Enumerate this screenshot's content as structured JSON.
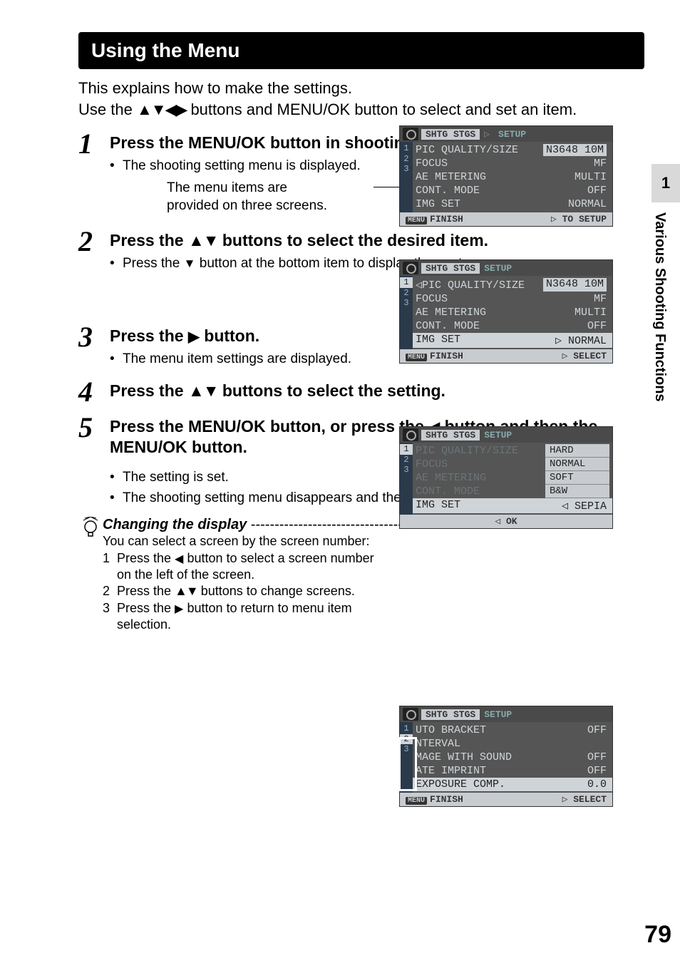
{
  "section_title": "Using the Menu",
  "intro_line1": "This explains how to make the settings.",
  "intro_line2_a": "Use the ",
  "intro_line2_b": " buttons and MENU/OK button to select and set an item.",
  "steps": {
    "s1": {
      "num": "1",
      "title": "Press the MENU/OK button in shooting mode.",
      "bullet": "The shooting setting menu is displayed.",
      "callout1": "The menu items are",
      "callout2": "provided on three screens."
    },
    "s2": {
      "num": "2",
      "title_a": "Press the ",
      "title_b": " buttons to select the desired item.",
      "bullet_a": "Press the ",
      "bullet_b": " button at the bottom item to display the next screen."
    },
    "s3": {
      "num": "3",
      "title_a": "Press the ",
      "title_b": " button.",
      "bullet": "The menu item settings are displayed."
    },
    "s4": {
      "num": "4",
      "title_a": "Press the ",
      "title_b": " buttons to select the setting."
    },
    "s5": {
      "num": "5",
      "title_a": "Press the MENU/OK button, or press the ",
      "title_b": " button and then the MENU/OK button.",
      "bullet1": "The setting is set.",
      "bullet2": "The shooting setting menu disappears and the camera is ready to shoot."
    }
  },
  "tip": {
    "title": "Changing the display",
    "dashes": " ------------------------------------------------------------------------",
    "intro": "You can select a screen by the screen number:",
    "i1_a": "Press the ",
    "i1_b": " button to select a screen number on the left of the screen.",
    "i2_a": "Press the ",
    "i2_b": " buttons to change screens.",
    "i3_a": "Press the ",
    "i3_b": " button to return to menu item selection."
  },
  "side": {
    "num": "1",
    "label": "Various Shooting Functions"
  },
  "page_number": "79",
  "lcd_common": {
    "tab1": "SHTG STGS",
    "tab2": "SETUP",
    "foot_finish": "FINISH",
    "foot_menu": "MENU"
  },
  "lcd1": {
    "pager": [
      "1",
      "2",
      "3"
    ],
    "rows": [
      {
        "l": "PIC QUALITY/SIZE",
        "v": "N3648 10M"
      },
      {
        "l": "FOCUS",
        "v": "MF"
      },
      {
        "l": "AE METERING",
        "v": "MULTI"
      },
      {
        "l": "CONT. MODE",
        "v": "OFF"
      },
      {
        "l": "IMG SET",
        "v": "NORMAL"
      }
    ],
    "foot_right": "▷ TO SETUP"
  },
  "lcd2": {
    "pager": [
      "1",
      "2",
      "3"
    ],
    "rows": [
      {
        "l": "◁PIC QUALITY/SIZE",
        "v": "N3648 10M"
      },
      {
        "l": "FOCUS",
        "v": "MF"
      },
      {
        "l": "AE METERING",
        "v": "MULTI"
      },
      {
        "l": "CONT. MODE",
        "v": "OFF"
      },
      {
        "l": "IMG SET",
        "v": "▷ NORMAL"
      }
    ],
    "foot_right": "▷ SELECT"
  },
  "lcd3": {
    "pager": [
      "1",
      "2",
      "3"
    ],
    "rows_dim": [
      "PIC QUALITY/SIZE",
      "FOCUS",
      "AE METERING",
      "CONT. MODE"
    ],
    "row_sel": "IMG SET",
    "opts": [
      "HARD",
      "NORMAL",
      "SOFT",
      "B&W",
      "SEPIA"
    ],
    "opt_sel": "◁ SEPIA",
    "foot_center": "◁ OK"
  },
  "lcd4": {
    "pager": [
      "1",
      "2",
      "3"
    ],
    "rows": [
      {
        "l": "UTO BRACKET",
        "v": "OFF"
      },
      {
        "l": "NTERVAL",
        "v": ""
      },
      {
        "l": "MAGE WITH SOUND",
        "v": "OFF"
      },
      {
        "l": "ATE IMPRINT",
        "v": "OFF"
      },
      {
        "l": "EXPOSURE COMP.",
        "v": "0.0"
      }
    ],
    "foot_right": "▷ SELECT"
  }
}
